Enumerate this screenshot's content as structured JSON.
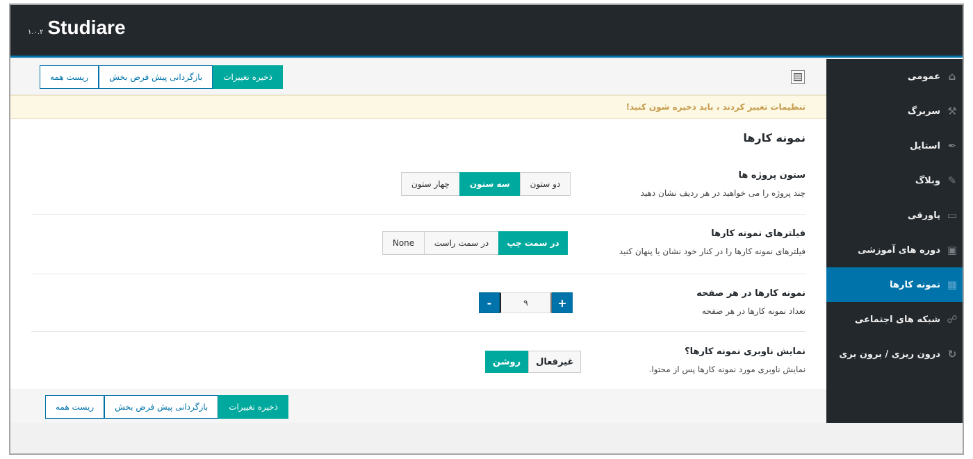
{
  "header": {
    "brand_name": "Studiare",
    "version": "۱.۰.۲"
  },
  "toolbar": {
    "save_label": "ذخیره تغییرات",
    "reset_section_label": "بازگردانی پیش فرض بخش",
    "reset_all_label": "ریست همه"
  },
  "notice": {
    "text": "تنظیمات تغییر کردند ، باید ذخیره شون کنید!"
  },
  "section": {
    "title": "نمونه کارها"
  },
  "fields": {
    "columns": {
      "label": "ستون پروژه ها",
      "description": "چند پروژه را می خواهید در هر ردیف نشان دهید",
      "options": [
        "دو ستون",
        "سه ستون",
        "چهار ستون"
      ],
      "selected": "سه ستون"
    },
    "filters": {
      "label": "فیلترهای نمونه کارها",
      "description": "فیلترهای نمونه کارها را در کنار خود نشان یا پنهان کنید",
      "options": [
        "در سمت چپ",
        "در سمت راست",
        "None"
      ],
      "selected": "در سمت چپ"
    },
    "per_page": {
      "label": "نمونه کارها در هر صفحه",
      "description": "تعداد نمونه کارها در هر صفحه",
      "value": "۹",
      "plus": "+",
      "minus": "-"
    },
    "navigation": {
      "label": "نمایش ناوبری نمونه کارها؟",
      "description": "نمایش ناوبری مورد نمونه کارها پس از محتوا.",
      "off_label": "غیرفعال",
      "on_label": "روشن",
      "state": "on"
    }
  },
  "sidebar": {
    "items": [
      {
        "label": "عمومی",
        "icon": "home-icon",
        "active": false
      },
      {
        "label": "سربرگ",
        "icon": "wrench-icon",
        "active": false
      },
      {
        "label": "استایل",
        "icon": "brush-icon",
        "active": false
      },
      {
        "label": "وبلاگ",
        "icon": "pencil-icon",
        "active": false
      },
      {
        "label": "پاورقی",
        "icon": "laptop-icon",
        "active": false
      },
      {
        "label": "دوره های آموزشی",
        "icon": "cart-icon",
        "active": false
      },
      {
        "label": "نمونه کارها",
        "icon": "grid-icon",
        "active": true
      },
      {
        "label": "شبکه های اجتماعی",
        "icon": "share-icon",
        "active": false
      },
      {
        "label": "درون ریزی / برون بری",
        "icon": "refresh-icon",
        "active": false
      }
    ]
  },
  "colors": {
    "accent": "#00a99d",
    "primary": "#0073aa",
    "sidebar_bg": "#23282d",
    "notice_bg": "#fcf8e3"
  }
}
